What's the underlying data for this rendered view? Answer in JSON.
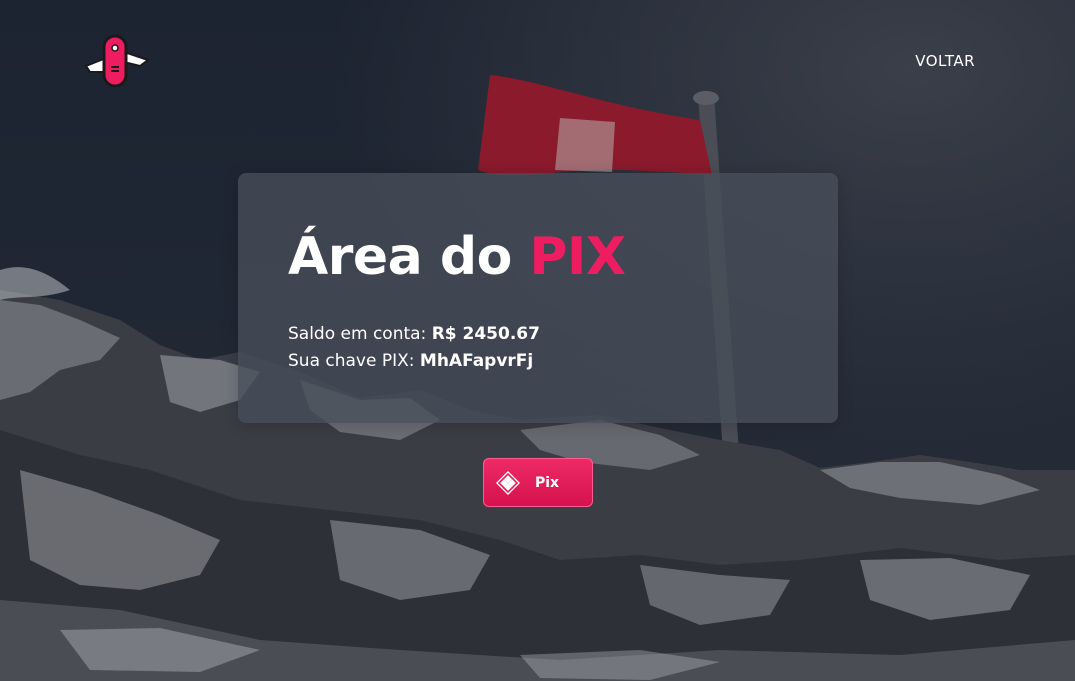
{
  "nav": {
    "back_label": "VOLTAR"
  },
  "card": {
    "title_prefix": "Área do ",
    "title_accent": "PIX",
    "balance_label": "Saldo em conta: ",
    "balance_value": "R$ 2450.67",
    "key_label": "Sua chave PIX: ",
    "key_value": "MhAFapvrFj"
  },
  "pix_button": {
    "label": "Pix"
  },
  "colors": {
    "accent": "#ee1d62",
    "card_bg": "#484e5a",
    "text": "#ffffff"
  }
}
